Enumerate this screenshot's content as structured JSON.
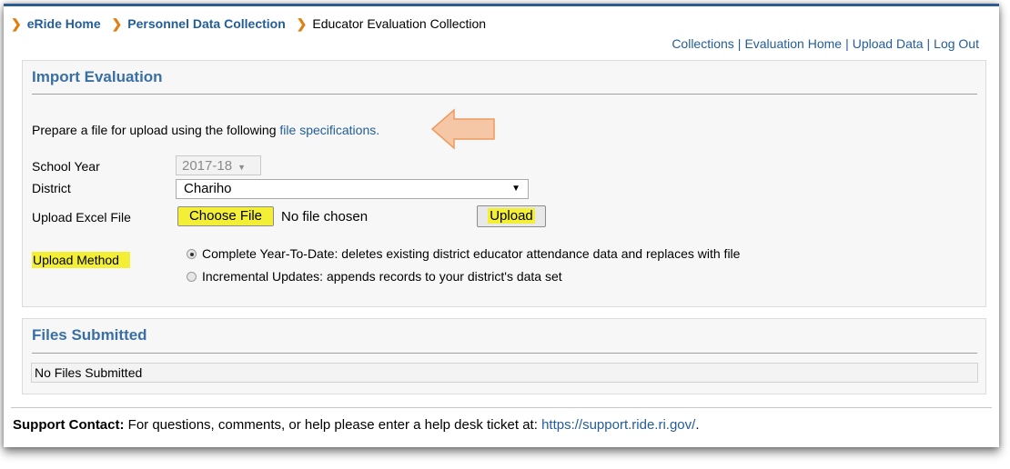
{
  "breadcrumb": {
    "home": "eRide Home",
    "section": "Personnel Data Collection",
    "current": "Educator Evaluation Collection"
  },
  "top_links": [
    "Collections",
    "Evaluation Home",
    "Upload Data",
    "Log Out"
  ],
  "import_panel": {
    "title": "Import Evaluation",
    "prep_text": "Prepare a file for upload using the following ",
    "prep_link": "file specifications.",
    "school_year_label": "School Year",
    "school_year_value": "2017-18",
    "district_label": "District",
    "district_value": "Chariho",
    "upload_file_label": "Upload Excel File",
    "choose_file_button": "Choose File",
    "no_file_text": "No file chosen",
    "upload_button": "Upload",
    "upload_method_label": "Upload Method",
    "methods": [
      {
        "label": "Complete Year-To-Date: deletes existing district educator attendance data and replaces with file",
        "selected": true
      },
      {
        "label": "Incremental Updates: appends records to your district's data set",
        "selected": false
      }
    ]
  },
  "files_panel": {
    "title": "Files Submitted",
    "empty_text": "No Files Submitted"
  },
  "support": {
    "label": "Support Contact:",
    "text": " For questions, comments, or help please enter a help desk ticket at: ",
    "link": "https://support.ride.ri.gov/",
    "tail": "."
  },
  "colors": {
    "link": "#235d9a",
    "highlight": "#f3ee36",
    "arrow_fill": "#f6c7a6",
    "arrow_stroke": "#ee9a5e",
    "breadcrumb_chevron": "#e07f14"
  }
}
